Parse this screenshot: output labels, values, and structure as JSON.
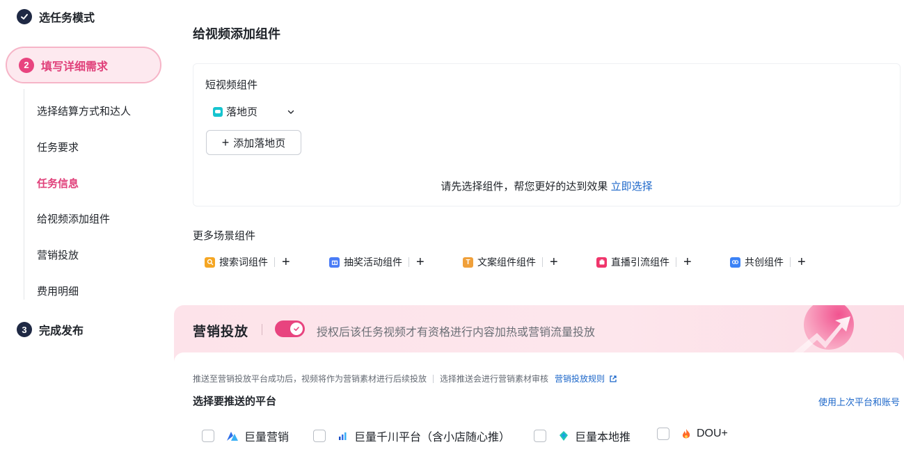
{
  "sidebar": {
    "steps": [
      {
        "number": "✓",
        "label": "选任务模式"
      },
      {
        "number": "2",
        "label": "填写详细需求"
      },
      {
        "number": "3",
        "label": "完成发布"
      }
    ],
    "sub_items": [
      {
        "label": "选择结算方式和达人"
      },
      {
        "label": "任务要求"
      },
      {
        "label": "任务信息"
      },
      {
        "label": "给视频添加组件"
      },
      {
        "label": "营销投放"
      },
      {
        "label": "费用明细"
      }
    ]
  },
  "components": {
    "title": "给视频添加组件",
    "short_video_label": "短视频组件",
    "selected_component": "落地页",
    "add_button_label": "添加落地页",
    "hint_text": "请先选择组件，帮您更好的达到效果",
    "hint_link": "立即选择",
    "more_label": "更多场景组件",
    "scenes": [
      {
        "label": "搜索词组件",
        "icon": "search-icon",
        "color": "#f5a623"
      },
      {
        "label": "抽奖活动组件",
        "icon": "gift-icon",
        "color": "#4a7cf6"
      },
      {
        "label": "文案组件组件",
        "icon": "text-icon",
        "color": "#f5a623"
      },
      {
        "label": "直播引流组件",
        "icon": "live-icon",
        "color": "#f0356b"
      },
      {
        "label": "共创组件",
        "icon": "co-create-icon",
        "color": "#3b82f6"
      }
    ]
  },
  "marketing": {
    "title": "营销投放",
    "toggle_on": true,
    "description": "授权后该任务视频才有资格进行内容加热或营销流量投放",
    "notice_1": "推送至营销投放平台成功后，视频将作为营销素材进行后续投放",
    "notice_2": "选择推送会进行营销素材审核",
    "rules_link": "营销投放规则",
    "choose_title": "选择要推送的平台",
    "use_last_link": "使用上次平台和账号",
    "platforms": [
      {
        "label": "巨量营销",
        "icon": "juliang-icon",
        "checked": false
      },
      {
        "label": "巨量千川平台（含小店随心推）",
        "icon": "qianchuan-icon",
        "checked": false
      },
      {
        "label": "巨量本地推",
        "icon": "bendi-icon",
        "checked": false
      },
      {
        "label": "DOU+",
        "icon": "dou-flame-icon",
        "checked": false
      }
    ]
  },
  "colors": {
    "accent_pink": "#e8447f",
    "link_blue": "#1b66c9",
    "dark_navy": "#1f2944"
  }
}
